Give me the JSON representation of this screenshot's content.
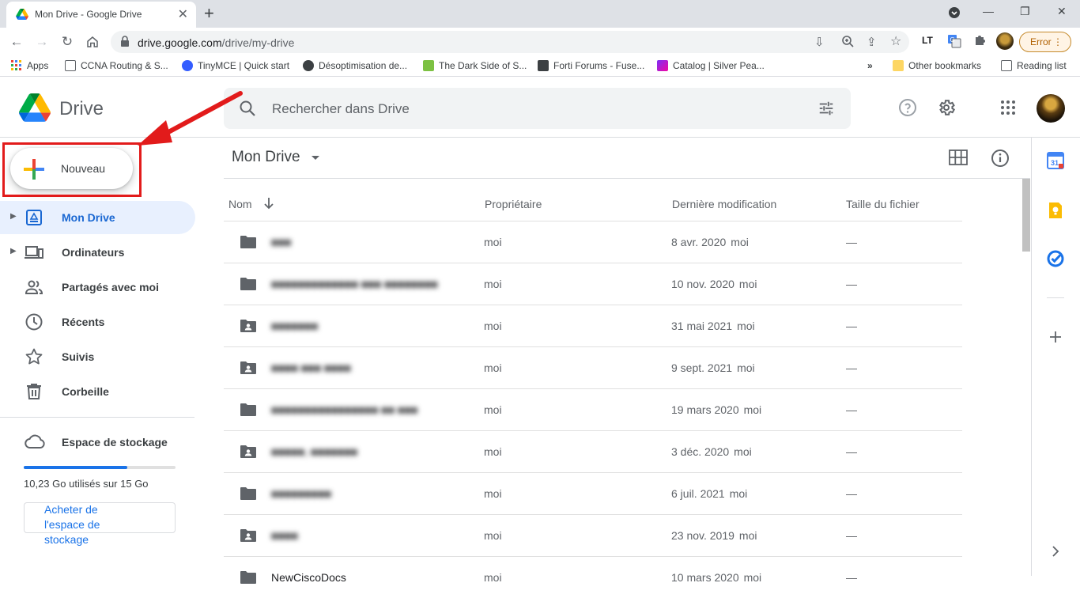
{
  "browser": {
    "tab_title": "Mon Drive - Google Drive",
    "url_host": "drive.google.com",
    "url_path": "/drive/my-drive",
    "error_label": "Error",
    "bookmarks": [
      {
        "label": "Apps"
      },
      {
        "label": "CCNA Routing & S..."
      },
      {
        "label": "TinyMCE | Quick start"
      },
      {
        "label": "Désoptimisation de..."
      },
      {
        "label": "The Dark Side of S..."
      },
      {
        "label": "Forti Forums - Fuse..."
      },
      {
        "label": "Catalog | Silver Pea..."
      }
    ],
    "overflow_label": "»",
    "other_bookmarks": "Other bookmarks",
    "reading_list": "Reading list"
  },
  "header": {
    "app_name": "Drive",
    "search_placeholder": "Rechercher dans Drive"
  },
  "sidebar": {
    "new_label": "Nouveau",
    "items": [
      {
        "label": "Mon Drive",
        "icon": "drive-folder-icon",
        "active": true
      },
      {
        "label": "Ordinateurs",
        "icon": "computers-icon"
      },
      {
        "label": "Partagés avec moi",
        "icon": "people-icon"
      },
      {
        "label": "Récents",
        "icon": "clock-icon"
      },
      {
        "label": "Suivis",
        "icon": "star-icon"
      },
      {
        "label": "Corbeille",
        "icon": "trash-icon"
      }
    ],
    "storage_label": "Espace de stockage",
    "storage_used_text": "10,23 Go utilisés sur 15 Go",
    "storage_fraction": 0.682,
    "buy_label": "Acheter de l'espace de stockage"
  },
  "main": {
    "title": "Mon Drive",
    "columns": {
      "name": "Nom",
      "owner": "Propriétaire",
      "modified": "Dernière modification",
      "size": "Taille du fichier"
    },
    "rows": [
      {
        "name": "■■■",
        "type": "folder",
        "owner": "moi",
        "date": "8 avr. 2020",
        "by": "moi",
        "size": "—"
      },
      {
        "name": "■■■■■■■■■■■■■ ■■■ ■■■■■■■■",
        "type": "folder",
        "owner": "moi",
        "date": "10 nov. 2020",
        "by": "moi",
        "size": "—"
      },
      {
        "name": "■■■■■■■",
        "type": "shared-folder",
        "owner": "moi",
        "date": "31 mai 2021",
        "by": "moi",
        "size": "—"
      },
      {
        "name": "■■■■ ■■■ ■■■■",
        "type": "shared-folder",
        "owner": "moi",
        "date": "9 sept. 2021",
        "by": "moi",
        "size": "—"
      },
      {
        "name": "■■■■■■■■■■■■■■■■ ■■ ■■■",
        "type": "folder",
        "owner": "moi",
        "date": "19 mars 2020",
        "by": "moi",
        "size": "—"
      },
      {
        "name": "■■■■■, ■■■■■■■",
        "type": "shared-folder",
        "owner": "moi",
        "date": "3 déc. 2020",
        "by": "moi",
        "size": "—"
      },
      {
        "name": "■■■■■■■■■",
        "type": "folder",
        "owner": "moi",
        "date": "6 juil. 2021",
        "by": "moi",
        "size": "—"
      },
      {
        "name": "■■■■",
        "type": "shared-folder",
        "owner": "moi",
        "date": "23 nov. 2019",
        "by": "moi",
        "size": "—"
      },
      {
        "name": "NewCiscoDocs",
        "type": "folder",
        "owner": "moi",
        "date": "10 mars 2020",
        "by": "moi",
        "size": "—"
      }
    ]
  },
  "colors": {
    "accent": "#1a73e8",
    "active_bg": "#e8f0fe",
    "annotation_red": "#e21b1b"
  }
}
